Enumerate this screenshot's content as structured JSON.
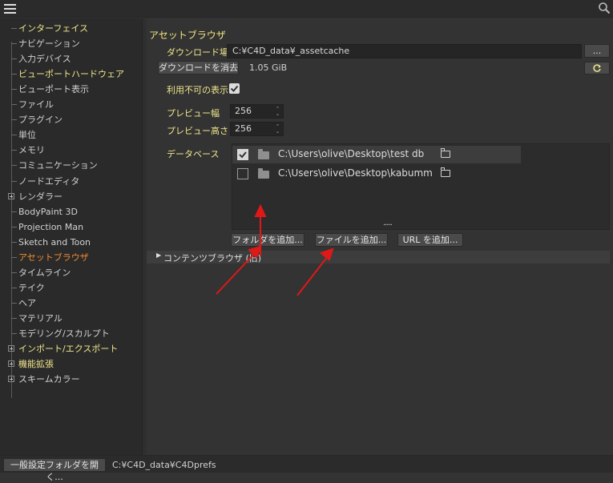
{
  "sidebar": {
    "items": [
      {
        "label": "インターフェイス",
        "style": "yellow",
        "expand": false
      },
      {
        "label": "ナビゲーション",
        "style": "normal",
        "expand": false
      },
      {
        "label": "入力デバイス",
        "style": "normal",
        "expand": false
      },
      {
        "label": "ビューポートハードウェア",
        "style": "yellow",
        "expand": false
      },
      {
        "label": "ビューポート表示",
        "style": "normal",
        "expand": false
      },
      {
        "label": "ファイル",
        "style": "normal",
        "expand": false
      },
      {
        "label": "プラグイン",
        "style": "normal",
        "expand": false
      },
      {
        "label": "単位",
        "style": "normal",
        "expand": false
      },
      {
        "label": "メモリ",
        "style": "normal",
        "expand": false
      },
      {
        "label": "コミュニケーション",
        "style": "normal",
        "expand": false
      },
      {
        "label": "ノードエディタ",
        "style": "normal",
        "expand": false
      },
      {
        "label": "レンダラー",
        "style": "normal",
        "expand": true
      },
      {
        "label": "BodyPaint 3D",
        "style": "normal",
        "expand": false
      },
      {
        "label": "Projection Man",
        "style": "normal",
        "expand": false
      },
      {
        "label": "Sketch and Toon",
        "style": "normal",
        "expand": false
      },
      {
        "label": "アセットブラウザ",
        "style": "active",
        "expand": false
      },
      {
        "label": "タイムライン",
        "style": "normal",
        "expand": false
      },
      {
        "label": "テイク",
        "style": "normal",
        "expand": false
      },
      {
        "label": "ヘア",
        "style": "normal",
        "expand": false
      },
      {
        "label": "マテリアル",
        "style": "normal",
        "expand": false
      },
      {
        "label": "モデリング/スカルプト",
        "style": "normal",
        "expand": false
      },
      {
        "label": "インポート/エクスポート",
        "style": "yellow",
        "expand": true
      },
      {
        "label": "機能拡張",
        "style": "yellow",
        "expand": true
      },
      {
        "label": "スキームカラー",
        "style": "normal",
        "expand": true
      }
    ]
  },
  "main": {
    "title": "アセットブラウザ",
    "download_location_label": "ダウンロード場所",
    "download_location_value": "C:¥C4D_data¥_assetcache",
    "browse_button": "...",
    "clear_download_button": "ダウンロードを消去",
    "cache_size": "1.05 GiB",
    "refresh_icon": "refresh-icon",
    "show_unavailable_label": "利用不可の表示",
    "show_unavailable_checked": true,
    "preview_width_label": "プレビュー幅",
    "preview_width_value": "256",
    "preview_height_label": "プレビュー高さ",
    "preview_height_value": "256",
    "database_label": "データベース",
    "databases": [
      {
        "path": "C:\\Users\\olive\\Desktop\\test db",
        "checked": true
      },
      {
        "path": "C:\\Users\\olive\\Desktop\\kabumm",
        "checked": false
      }
    ],
    "resize_handle": "·····",
    "add_folder_button": "フォルダを追加...",
    "add_file_button": "ファイルを追加...",
    "add_url_button": "URL を追加...",
    "content_browser_label": "コンテンツブラウザ (旧)"
  },
  "footer": {
    "open_prefs_button": "一般設定フォルダを開く...",
    "prefs_path": "C:¥C4D_data¥C4Dprefs"
  },
  "colors": {
    "accent_yellow": "#f0e68c",
    "active_orange": "#f08c32",
    "annotation_arrow": "#e01818"
  }
}
